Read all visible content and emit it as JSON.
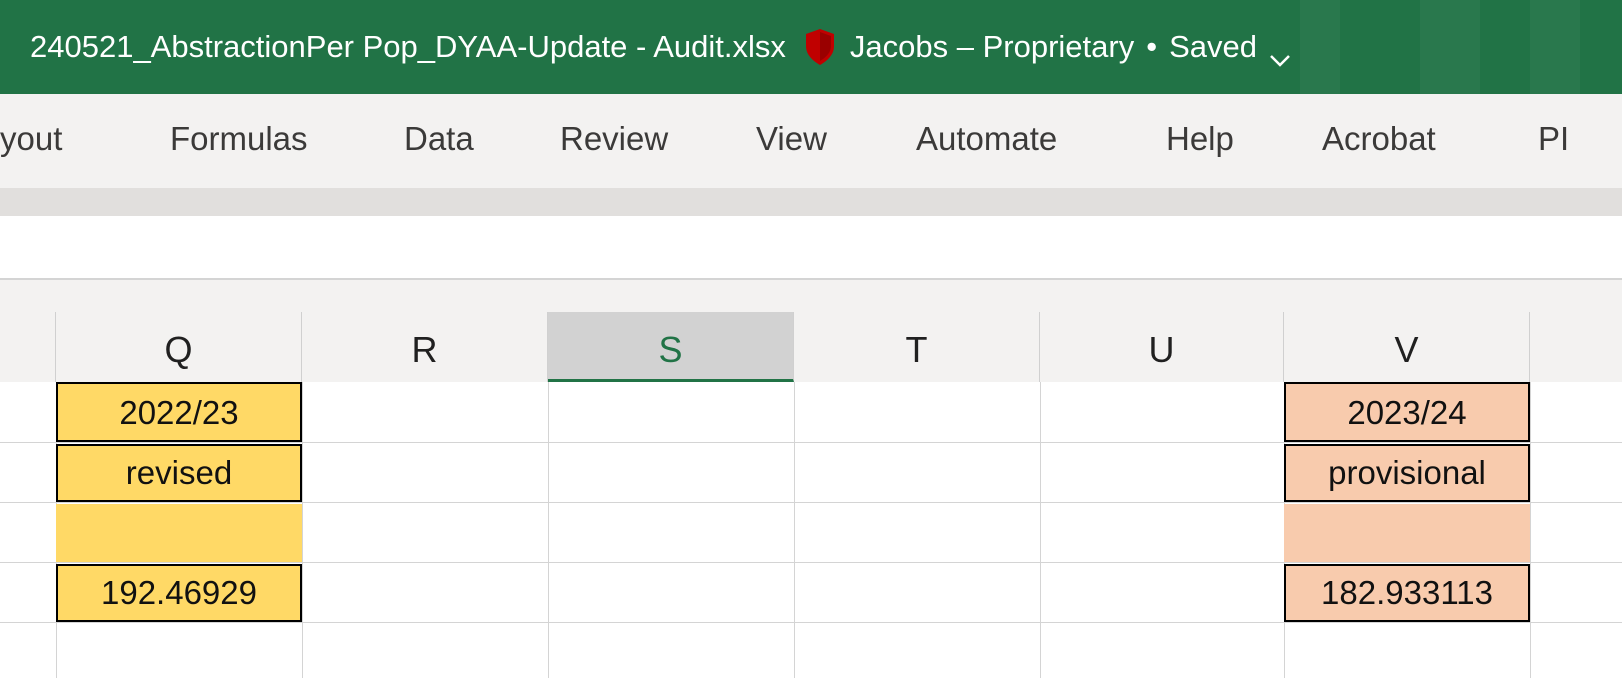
{
  "window": {
    "title": "240521_AbstractionPer Pop_DYAA-Update - Audit.xlsx",
    "sensitivity_label": "Jacobs – Proprietary",
    "bullet": "•",
    "save_status": "Saved",
    "icons": [
      "shield-icon",
      "chevron-down-icon"
    ],
    "colors": {
      "titlebar": "#217346",
      "shield": "#c00000"
    }
  },
  "ribbon": {
    "tabs": [
      "yout",
      "Formulas",
      "Data",
      "Review",
      "View",
      "Automate",
      "Help",
      "Acrobat",
      "PI"
    ]
  },
  "sheet": {
    "columns": [
      {
        "letter": "Q",
        "selected": false
      },
      {
        "letter": "R",
        "selected": false
      },
      {
        "letter": "S",
        "selected": true
      },
      {
        "letter": "T",
        "selected": false
      },
      {
        "letter": "U",
        "selected": false
      },
      {
        "letter": "V",
        "selected": false
      }
    ],
    "col_q": [
      "2022/23",
      "revised",
      "",
      "192.46929"
    ],
    "col_v": [
      "2023/24",
      "provisional",
      "",
      "182.933113"
    ],
    "fill_colors": {
      "q": "#ffd966",
      "v": "#f8cbad"
    }
  }
}
